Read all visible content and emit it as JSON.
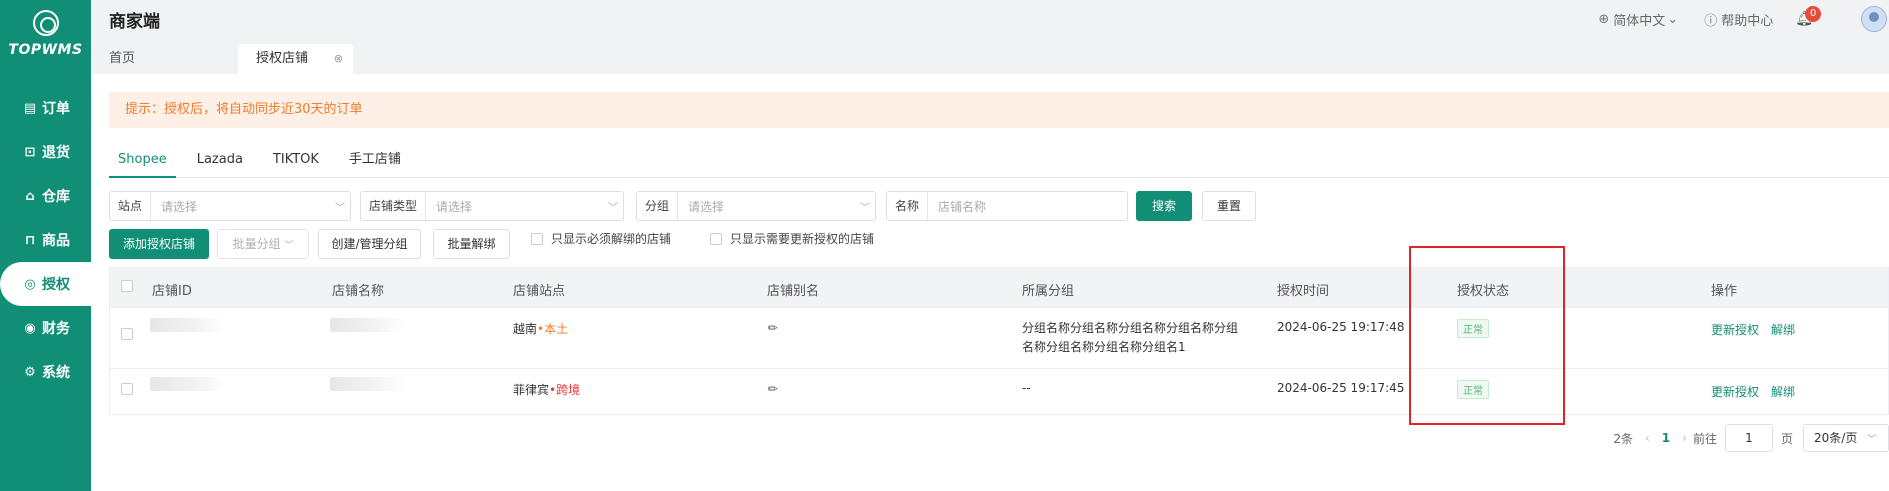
{
  "app": {
    "logo_text": "TOPWMS",
    "brand": "商家端"
  },
  "sidebar": {
    "items": [
      {
        "label": "订单",
        "icon": "order-icon",
        "glyph": "▤"
      },
      {
        "label": "退货",
        "icon": "return-icon",
        "glyph": "⊡"
      },
      {
        "label": "仓库",
        "icon": "warehouse-icon",
        "glyph": "⌂"
      },
      {
        "label": "商品",
        "icon": "product-icon",
        "glyph": "⊓"
      },
      {
        "label": "授权",
        "icon": "auth-icon",
        "glyph": "◎",
        "active": true
      },
      {
        "label": "财务",
        "icon": "finance-icon",
        "glyph": "◉"
      },
      {
        "label": "系统",
        "icon": "system-icon",
        "glyph": "⚙"
      }
    ]
  },
  "header": {
    "language": "简体中文",
    "help": "帮助中心",
    "notification_count": "0"
  },
  "page_tabs": {
    "home": "首页",
    "current": "授权店铺",
    "close_glyph": "⊗"
  },
  "notice": "提示：授权后，将自动同步近30天的订单",
  "platform_tabs": [
    "Shopee",
    "Lazada",
    "TIKTOK",
    "手工店铺"
  ],
  "filters": {
    "site_label": "站点",
    "site_placeholder": "请选择",
    "store_type_label": "店铺类型",
    "store_type_placeholder": "请选择",
    "group_label": "分组",
    "group_placeholder": "请选择",
    "name_label": "名称",
    "name_placeholder": "店铺名称",
    "search": "搜索",
    "reset": "重置"
  },
  "actions": {
    "add_store": "添加授权店铺",
    "batch_group": "批量分组",
    "manage_group": "创建/管理分组",
    "batch_unbind": "批量解绑",
    "only_must_unbind": "只显示必须解绑的店铺",
    "only_need_reauth": "只显示需要更新授权的店铺"
  },
  "table": {
    "columns": [
      "店铺ID",
      "店铺名称",
      "店铺站点",
      "店铺别名",
      "所属分组",
      "授权时间",
      "授权状态",
      "操作"
    ],
    "rows": [
      {
        "site_country": "越南",
        "site_sep": "•",
        "site_type": "本土",
        "group_line1": "分组名称分组名称分组名称分组名称分组",
        "group_line2": "名称分组名称分组名称分组名1",
        "auth_time": "2024-06-25 19:17:48",
        "status": "正常",
        "action_reauth": "更新授权",
        "action_unbind": "解绑"
      },
      {
        "site_country": "菲律宾",
        "site_sep": "•",
        "site_type": "跨境",
        "group_line1": "--",
        "group_line2": "",
        "auth_time": "2024-06-25 19:17:45",
        "status": "正常",
        "action_reauth": "更新授权",
        "action_unbind": "解绑"
      }
    ]
  },
  "pagination": {
    "total": "2条",
    "current_page": "1",
    "goto_label": "前往",
    "goto_value": "1",
    "page_unit": "页",
    "page_size": "20条/页"
  },
  "colors": {
    "primary": "#118f76",
    "notice_bg": "#fef0e6",
    "notice_text": "#f07c2e",
    "highlight": "#e02424"
  }
}
